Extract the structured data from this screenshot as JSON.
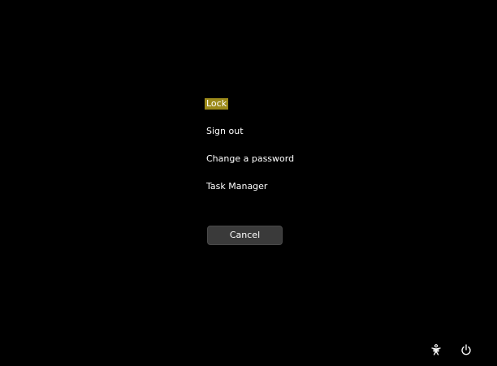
{
  "menu": {
    "items": [
      {
        "label": "Lock",
        "selected": true
      },
      {
        "label": "Sign out",
        "selected": false
      },
      {
        "label": "Change a password",
        "selected": false
      },
      {
        "label": "Task Manager",
        "selected": false
      }
    ]
  },
  "cancel_label": "Cancel",
  "icons": {
    "accessibility": "accessibility-icon",
    "power": "power-icon"
  },
  "colors": {
    "background": "#000000",
    "selection": "#9c8a1a",
    "button": "#3a3a3a",
    "text": "#ffffff"
  }
}
